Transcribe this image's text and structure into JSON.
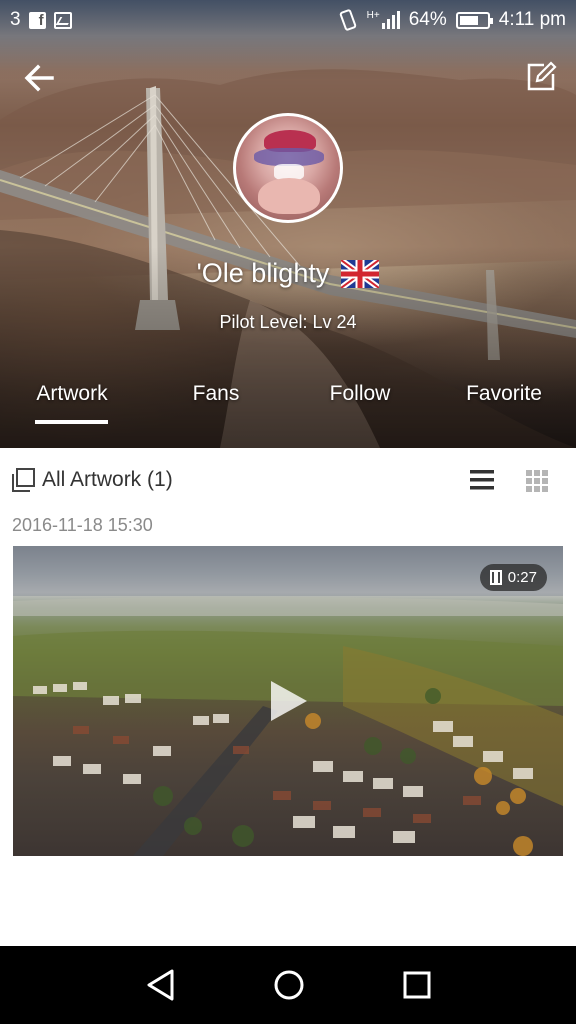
{
  "status_bar": {
    "notification_count": "3",
    "network": "H+",
    "battery_percent": "64%",
    "time": "4:11 pm"
  },
  "toolbar": {
    "back_icon": "arrow-left-icon",
    "edit_icon": "edit-icon"
  },
  "profile": {
    "username": "'Ole blighty",
    "flag": "uk-flag-icon",
    "pilot_level": "Pilot Level: Lv 24"
  },
  "tabs": [
    {
      "label": "Artwork",
      "active": true
    },
    {
      "label": "Fans",
      "active": false
    },
    {
      "label": "Follow",
      "active": false
    },
    {
      "label": "Favorite",
      "active": false
    }
  ],
  "artwork": {
    "section_title": "All Artwork (1)",
    "view_modes": [
      "list-view-icon",
      "grid-view-icon"
    ],
    "active_view": "list",
    "posts": [
      {
        "date": "2016-11-18 15:30",
        "type": "video",
        "duration": "0:27"
      }
    ]
  },
  "nav_bar": {
    "icons": [
      "back-triangle-icon",
      "home-circle-icon",
      "recents-square-icon"
    ]
  },
  "colors": {
    "accent": "#ffffff",
    "title_text": "#333333",
    "muted_text": "#8a8a8a",
    "nav_bar": "#000000"
  }
}
